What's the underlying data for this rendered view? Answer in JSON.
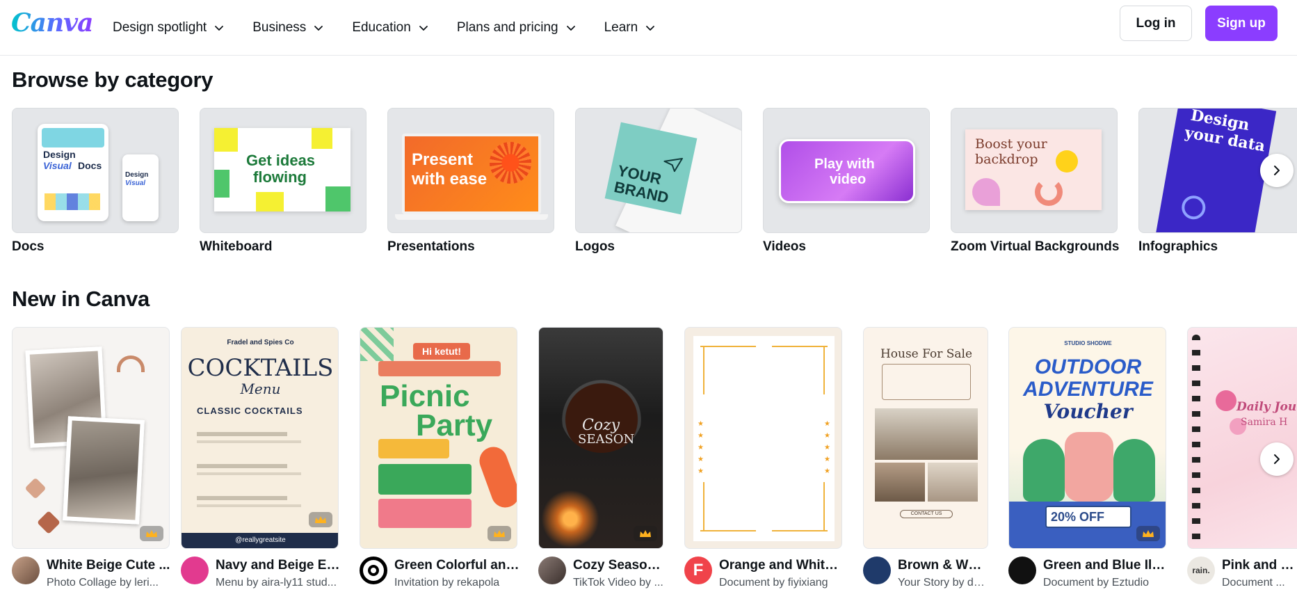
{
  "header": {
    "logo": "Canva",
    "nav": [
      {
        "label": "Design spotlight"
      },
      {
        "label": "Business"
      },
      {
        "label": "Education"
      },
      {
        "label": "Plans and pricing"
      },
      {
        "label": "Learn"
      }
    ],
    "login": "Log in",
    "signup": "Sign up"
  },
  "browse": {
    "title": "Browse by category",
    "categories": [
      {
        "label": "Docs",
        "art": [
          "Design",
          "Visual",
          "Docs"
        ]
      },
      {
        "label": "Whiteboard",
        "art": [
          "Get ideas",
          "flowing"
        ]
      },
      {
        "label": "Presentations",
        "art": [
          "Present",
          "with ease"
        ]
      },
      {
        "label": "Logos",
        "art": [
          "YOUR",
          "BRAND"
        ]
      },
      {
        "label": "Videos",
        "art": [
          "Play with",
          "video"
        ]
      },
      {
        "label": "Zoom Virtual Backgrounds",
        "art": [
          "Boost your",
          "backdrop"
        ]
      },
      {
        "label": "Infographics",
        "art": [
          "Design",
          "your data"
        ]
      }
    ]
  },
  "new_in_canva": {
    "title": "New in Canva",
    "templates": [
      {
        "title": "White Beige Cute ...",
        "subtitle": "Photo Collage by leri...",
        "avatar": ""
      },
      {
        "title": "Navy and Beige Ele...",
        "subtitle": "Menu by aira-ly11 stud...",
        "avatar": "",
        "art": [
          "Fradel and Spies Co",
          "COCKTAILS",
          "Menu",
          "CLASSIC COCKTAILS",
          "@reallygreatsite"
        ]
      },
      {
        "title": "Green Colorful and...",
        "subtitle": "Invitation by rekapola",
        "avatar": "",
        "art": [
          "Hi ketut!",
          "Picnic",
          "Party"
        ]
      },
      {
        "title": "Cozy Season ...",
        "subtitle": "TikTok Video by ...",
        "avatar": "",
        "art": [
          "Cozy",
          "SEASON"
        ]
      },
      {
        "title": "Orange and White ...",
        "subtitle": "Document by fiyixiang",
        "avatar": "F"
      },
      {
        "title": "Brown & Whit...",
        "subtitle": "Your Story by da...",
        "avatar": "",
        "art": [
          "House For Sale",
          "CONTACT US"
        ]
      },
      {
        "title": "Green and Blue Illu...",
        "subtitle": "Document by Eztudio",
        "avatar": "",
        "art": [
          "STUDIO SHODWE",
          "OUTDOOR",
          "ADVENTURE",
          "Voucher",
          "20% OFF"
        ]
      },
      {
        "title": "Pink and W...",
        "subtitle": "Document ...",
        "avatar": "rain.",
        "art": [
          "Daily Jou",
          "Samira H"
        ]
      }
    ]
  },
  "icons": {
    "chevron": "chevron-down-icon",
    "next": "chevron-right-icon",
    "premium": "crown-icon"
  },
  "colors": {
    "brand_purple": "#8b3dff",
    "brand_teal": "#00c4cc"
  }
}
